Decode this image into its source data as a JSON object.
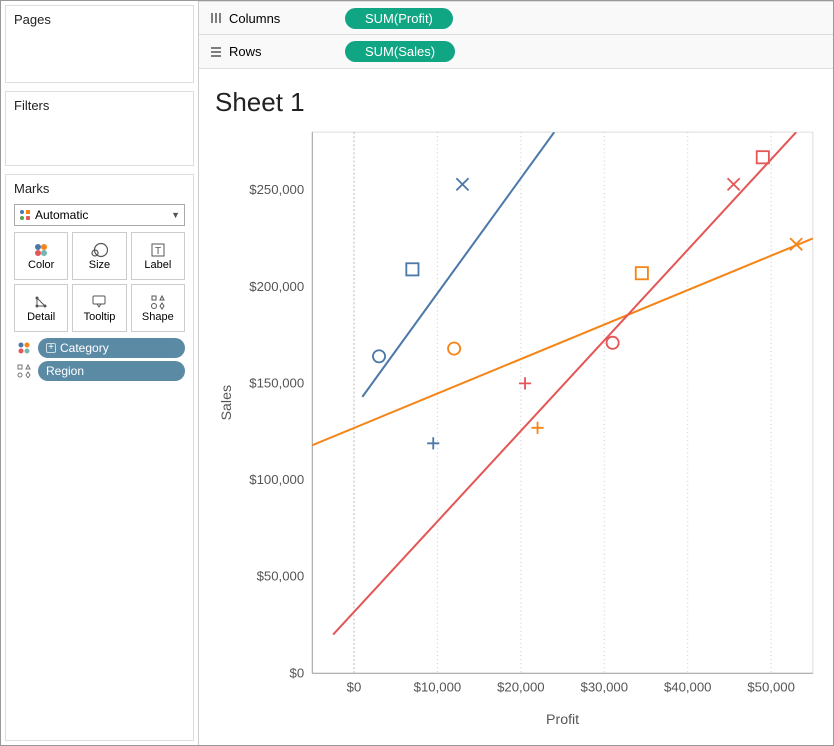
{
  "left": {
    "pages_label": "Pages",
    "filters_label": "Filters",
    "marks_label": "Marks",
    "marks_dropdown": "Automatic",
    "cards": {
      "color": "Color",
      "size": "Size",
      "label": "Label",
      "detail": "Detail",
      "tooltip": "Tooltip",
      "shape": "Shape"
    },
    "pills": {
      "category": "Category",
      "region": "Region"
    }
  },
  "shelves": {
    "columns_label": "Columns",
    "rows_label": "Rows",
    "columns_pill": "SUM(Profit)",
    "rows_pill": "SUM(Sales)"
  },
  "sheet_title": "Sheet 1",
  "axes": {
    "x_label": "Profit",
    "y_label": "Sales"
  },
  "chart_data": {
    "type": "scatter",
    "title": "Sheet 1",
    "xlabel": "Profit",
    "ylabel": "Sales",
    "xlim": [
      -5000,
      55000
    ],
    "ylim": [
      0,
      280000
    ],
    "x_ticks": [
      0,
      10000,
      20000,
      30000,
      40000,
      50000
    ],
    "x_tick_labels": [
      "$0",
      "$10,000",
      "$20,000",
      "$30,000",
      "$40,000",
      "$50,000"
    ],
    "y_ticks": [
      0,
      50000,
      100000,
      150000,
      200000,
      250000
    ],
    "y_tick_labels": [
      "$0",
      "$50,000",
      "$100,000",
      "$150,000",
      "$200,000",
      "$250,000"
    ],
    "series": [
      {
        "name": "Blue",
        "color": "#4c78a8",
        "points": [
          {
            "x": 3000,
            "y": 164000,
            "shape": "circle"
          },
          {
            "x": 7000,
            "y": 209000,
            "shape": "square"
          },
          {
            "x": 9500,
            "y": 119000,
            "shape": "plus"
          },
          {
            "x": 13000,
            "y": 253000,
            "shape": "cross"
          }
        ],
        "trend": {
          "x1": 1000,
          "y1": 143000,
          "x2": 24000,
          "y2": 280000
        }
      },
      {
        "name": "Orange",
        "color": "#f58518",
        "points": [
          {
            "x": 12000,
            "y": 168000,
            "shape": "circle"
          },
          {
            "x": 34500,
            "y": 207000,
            "shape": "square"
          },
          {
            "x": 22000,
            "y": 127000,
            "shape": "plus"
          },
          {
            "x": 53000,
            "y": 222000,
            "shape": "cross"
          }
        ],
        "trend": {
          "x1": -5000,
          "y1": 118000,
          "x2": 55000,
          "y2": 225000
        }
      },
      {
        "name": "Red",
        "color": "#e45756",
        "points": [
          {
            "x": 31000,
            "y": 171000,
            "shape": "circle"
          },
          {
            "x": 49000,
            "y": 267000,
            "shape": "square"
          },
          {
            "x": 20500,
            "y": 150000,
            "shape": "plus"
          },
          {
            "x": 45500,
            "y": 253000,
            "shape": "cross"
          }
        ],
        "trend": {
          "x1": -2500,
          "y1": 20000,
          "x2": 53000,
          "y2": 280000
        }
      }
    ]
  }
}
